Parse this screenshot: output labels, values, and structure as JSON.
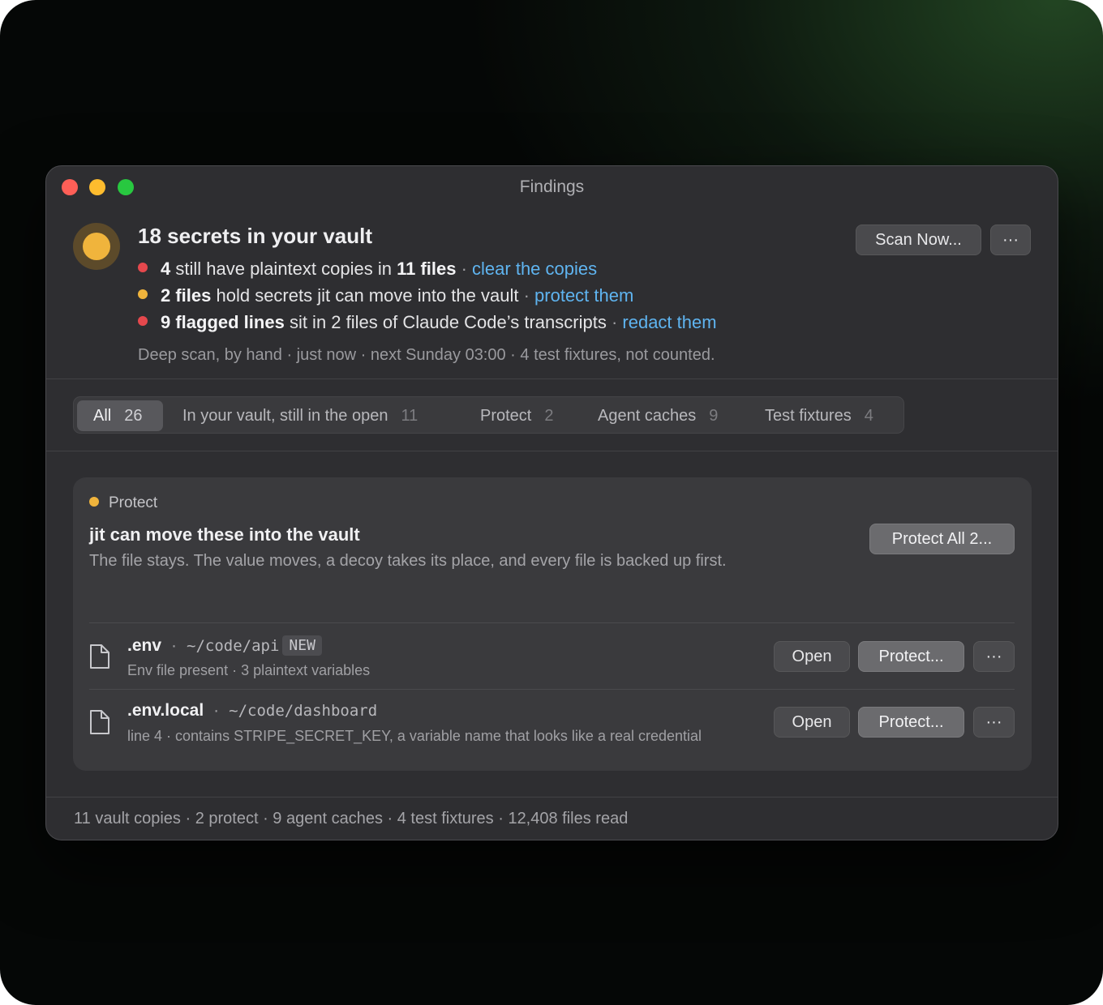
{
  "window": {
    "title": "Findings"
  },
  "colors": {
    "accent_link": "#5fb4f0",
    "status_red": "#e5484d",
    "status_yellow": "#f0b43c"
  },
  "header": {
    "headline": "18 secrets in your vault",
    "findings": [
      {
        "color": "#e5484d",
        "bold1": "4",
        "text1": " still have plaintext copies in ",
        "bold2": "11 files",
        "sep": " · ",
        "link": "clear the copies"
      },
      {
        "color": "#f0b43c",
        "bold1": "2 files",
        "text1": " hold secrets jit can move into the vault",
        "bold2": "",
        "sep": " · ",
        "link": "protect them"
      },
      {
        "color": "#e5484d",
        "bold1": "9 flagged lines",
        "text1": " sit in 2 files of Claude Code’s transcripts",
        "bold2": "",
        "sep": " · ",
        "link": "redact them"
      }
    ],
    "meta": "Deep scan, by hand · just now · next Sunday 03:00 · 4 test fixtures, not counted.",
    "scan_button": "Scan Now...",
    "more_button": "···"
  },
  "tabs": [
    {
      "label": "All",
      "count": "26"
    },
    {
      "label": "In your vault, still in the open",
      "count": "11"
    },
    {
      "label": "Protect",
      "count": "2"
    },
    {
      "label": "Agent caches",
      "count": "9"
    },
    {
      "label": "Test fixtures",
      "count": "4"
    }
  ],
  "card": {
    "group_label": "Protect",
    "title": "jit can move these into the vault",
    "description": "The file stays. The value moves, a decoy takes its place, and every file is backed up first.",
    "protect_all_button": "Protect All 2...",
    "rows": [
      {
        "name": ".env",
        "sep": "·",
        "path": "~/code/api",
        "badge": "NEW",
        "sub": "Env file present · 3 plaintext variables",
        "open": "Open",
        "protect": "Protect...",
        "more": "···"
      },
      {
        "name": ".env.local",
        "sep": "·",
        "path": "~/code/dashboard",
        "badge": "",
        "sub": "line 4 · contains STRIPE_SECRET_KEY, a variable name that looks like a real credential",
        "open": "Open",
        "protect": "Protect...",
        "more": "···"
      }
    ]
  },
  "footer": {
    "summary": "11 vault copies · 2 protect · 9 agent caches · 4 test fixtures · 12,408 files read"
  }
}
